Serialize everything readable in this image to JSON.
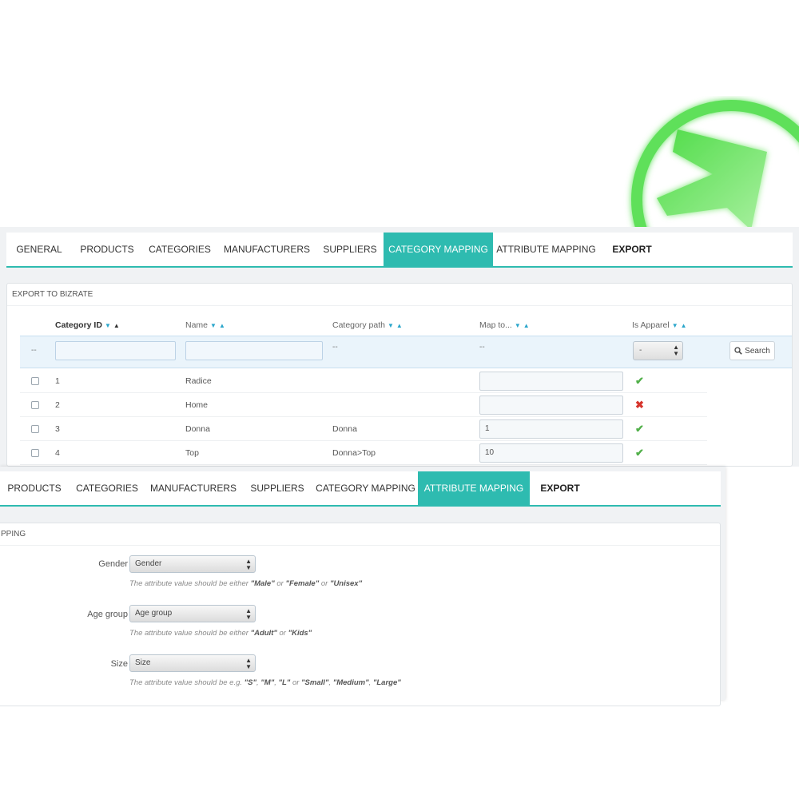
{
  "logo": {
    "name": "arrow-logo"
  },
  "panel1": {
    "tabs": [
      {
        "label": "General",
        "active": false
      },
      {
        "label": "Products",
        "active": false
      },
      {
        "label": "Categories",
        "active": false
      },
      {
        "label": "Manufacturers",
        "active": false
      },
      {
        "label": "Suppliers",
        "active": false
      },
      {
        "label": "Category Mapping",
        "active": true
      },
      {
        "label": "Attribute Mapping",
        "active": false
      },
      {
        "label": "Export",
        "active": false
      }
    ],
    "section_title": "EXPORT TO BIZRATE",
    "columns": [
      "Category ID",
      "Name",
      "Category path",
      "Map to...",
      "Is Apparel"
    ],
    "filter_dash": "--",
    "filter_select": "-",
    "search_label": "Search",
    "rows": [
      {
        "id": "1",
        "name": "Radice",
        "path": "",
        "map": "",
        "apparel": true
      },
      {
        "id": "2",
        "name": "Home",
        "path": "",
        "map": "",
        "apparel": false
      },
      {
        "id": "3",
        "name": "Donna",
        "path": "Donna",
        "map": "1",
        "apparel": true
      },
      {
        "id": "4",
        "name": "Top",
        "path": "Donna>Top",
        "map": "10",
        "apparel": true
      }
    ]
  },
  "panel2": {
    "tabs": [
      {
        "label": "Products",
        "active": false
      },
      {
        "label": "Categories",
        "active": false
      },
      {
        "label": "Manufacturers",
        "active": false
      },
      {
        "label": "Suppliers",
        "active": false
      },
      {
        "label": "Category Mapping",
        "active": false
      },
      {
        "label": "Attribute Mapping",
        "active": true
      },
      {
        "label": "Export",
        "active": false
      }
    ],
    "section_title": "PPING",
    "fields": {
      "gender": {
        "label": "Gender",
        "value": "Gender",
        "help_prefix": "The attribute value should be either ",
        "help_values": [
          "\"Male\"",
          " or ",
          "\"Female\"",
          " or ",
          "\"Unisex\""
        ]
      },
      "age": {
        "label": "Age group",
        "value": "Age group",
        "help_prefix": "The attribute value should be either ",
        "help_values": [
          "\"Adult\"",
          " or ",
          "\"Kids\""
        ]
      },
      "size": {
        "label": "Size",
        "value": "Size",
        "help_prefix": "The attribute value should be e.g. ",
        "help_values": [
          "\"S\"",
          ", ",
          "\"M\"",
          ", ",
          "\"L\"",
          " or ",
          "\"Small\"",
          ", ",
          "\"Medium\"",
          ", ",
          "\"Large\""
        ]
      }
    }
  },
  "icons": {
    "check": "check-icon",
    "cross": "cross-icon",
    "search": "search-icon",
    "sort": "sort-arrows-icon"
  },
  "colors": {
    "accent": "#2ebbb0",
    "ok": "#52b04a",
    "error": "#d6352c",
    "sort_arrow": "#2ba6cb"
  }
}
